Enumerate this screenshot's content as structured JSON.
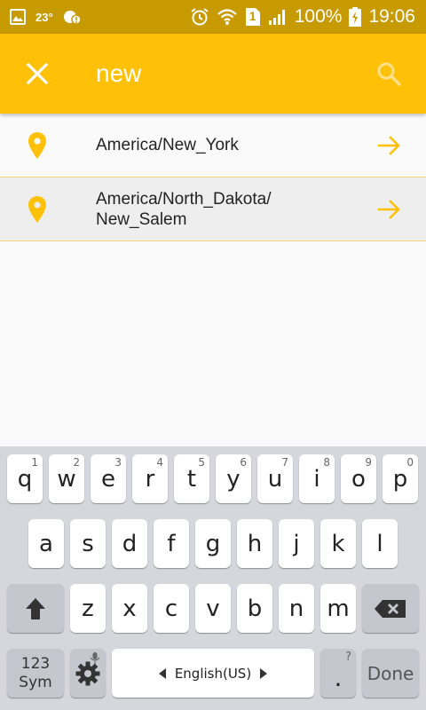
{
  "status_bar": {
    "temperature": "23°",
    "sim_number": "1",
    "battery": "100%",
    "time": "19:06"
  },
  "app_bar": {
    "query": "new",
    "close_icon": "close-icon",
    "search_icon": "search-icon",
    "color": "#ffc107"
  },
  "results": [
    {
      "label": "America/New_York"
    },
    {
      "label": "America/North_Dakota/\nNew_Salem"
    }
  ],
  "keyboard": {
    "row1": [
      {
        "key": "q",
        "hint": "1"
      },
      {
        "key": "w",
        "hint": "2"
      },
      {
        "key": "e",
        "hint": "3"
      },
      {
        "key": "r",
        "hint": "4"
      },
      {
        "key": "t",
        "hint": "5"
      },
      {
        "key": "y",
        "hint": "6"
      },
      {
        "key": "u",
        "hint": "7"
      },
      {
        "key": "i",
        "hint": "8"
      },
      {
        "key": "o",
        "hint": "9"
      },
      {
        "key": "p",
        "hint": "0"
      }
    ],
    "row2": [
      "a",
      "s",
      "d",
      "f",
      "g",
      "h",
      "j",
      "k",
      "l"
    ],
    "row3": [
      "z",
      "x",
      "c",
      "v",
      "b",
      "n",
      "m"
    ],
    "sym_label_1": "123",
    "sym_label_2": "Sym",
    "language": "English(US)",
    "period": ".",
    "period_hint": "?",
    "done_label": "Done"
  }
}
